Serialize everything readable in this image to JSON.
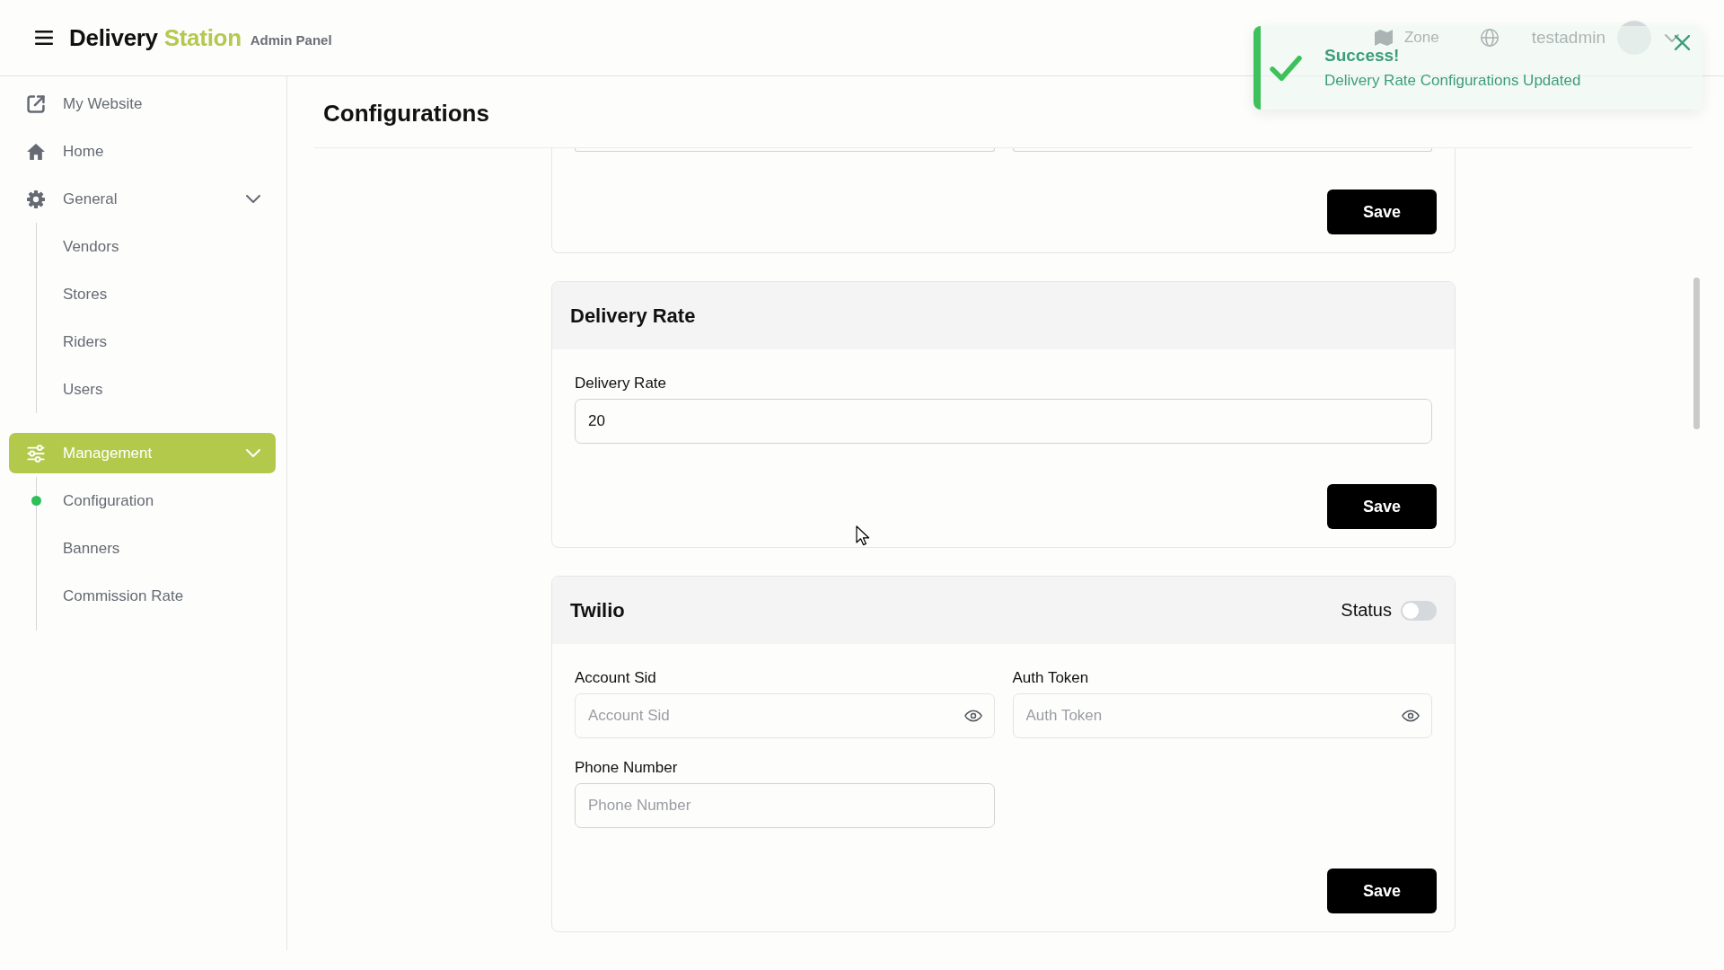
{
  "header": {
    "brand": {
      "name": "Delivery",
      "accent": "Station"
    },
    "subtitle": "Admin Panel",
    "zone_label": "Zone",
    "username": "testadmin"
  },
  "toast": {
    "kind": "success",
    "title": "Success!",
    "message": "Delivery Rate Configurations Updated"
  },
  "sidebar": {
    "items": [
      {
        "label": "My Website",
        "selected": false
      },
      {
        "label": "Home",
        "selected": false
      },
      {
        "label": "General",
        "selected": false,
        "expanded": true,
        "children": [
          {
            "label": "Vendors",
            "selected": false
          },
          {
            "label": "Stores",
            "selected": false
          },
          {
            "label": "Riders",
            "selected": false
          },
          {
            "label": "Users",
            "selected": false
          }
        ]
      },
      {
        "label": "Management",
        "selected": true,
        "expanded": true,
        "children": [
          {
            "label": "Configuration",
            "selected": true
          },
          {
            "label": "Banners",
            "selected": false
          },
          {
            "label": "Commission Rate",
            "selected": false
          }
        ]
      }
    ]
  },
  "main": {
    "title": "Configurations",
    "cards": [
      {
        "kind": "clipped",
        "fields": [
          {
            "kind": "text"
          },
          {
            "kind": "text"
          }
        ],
        "button": "Save"
      },
      {
        "kind": "single",
        "title": "Delivery Rate",
        "fields": [
          {
            "kind": "text",
            "label": "Delivery Rate",
            "value": "20"
          }
        ],
        "button": "Save"
      },
      {
        "kind": "grid",
        "title": "Twilio",
        "status": {
          "label": "Status",
          "on": false
        },
        "fields": [
          {
            "kind": "secret",
            "label": "Account Sid",
            "placeholder": "Account Sid"
          },
          {
            "kind": "secret",
            "label": "Auth Token",
            "placeholder": "Auth Token"
          },
          {
            "kind": "text",
            "label": "Phone Number",
            "placeholder": "Phone Number"
          }
        ],
        "button": "Save"
      }
    ]
  }
}
